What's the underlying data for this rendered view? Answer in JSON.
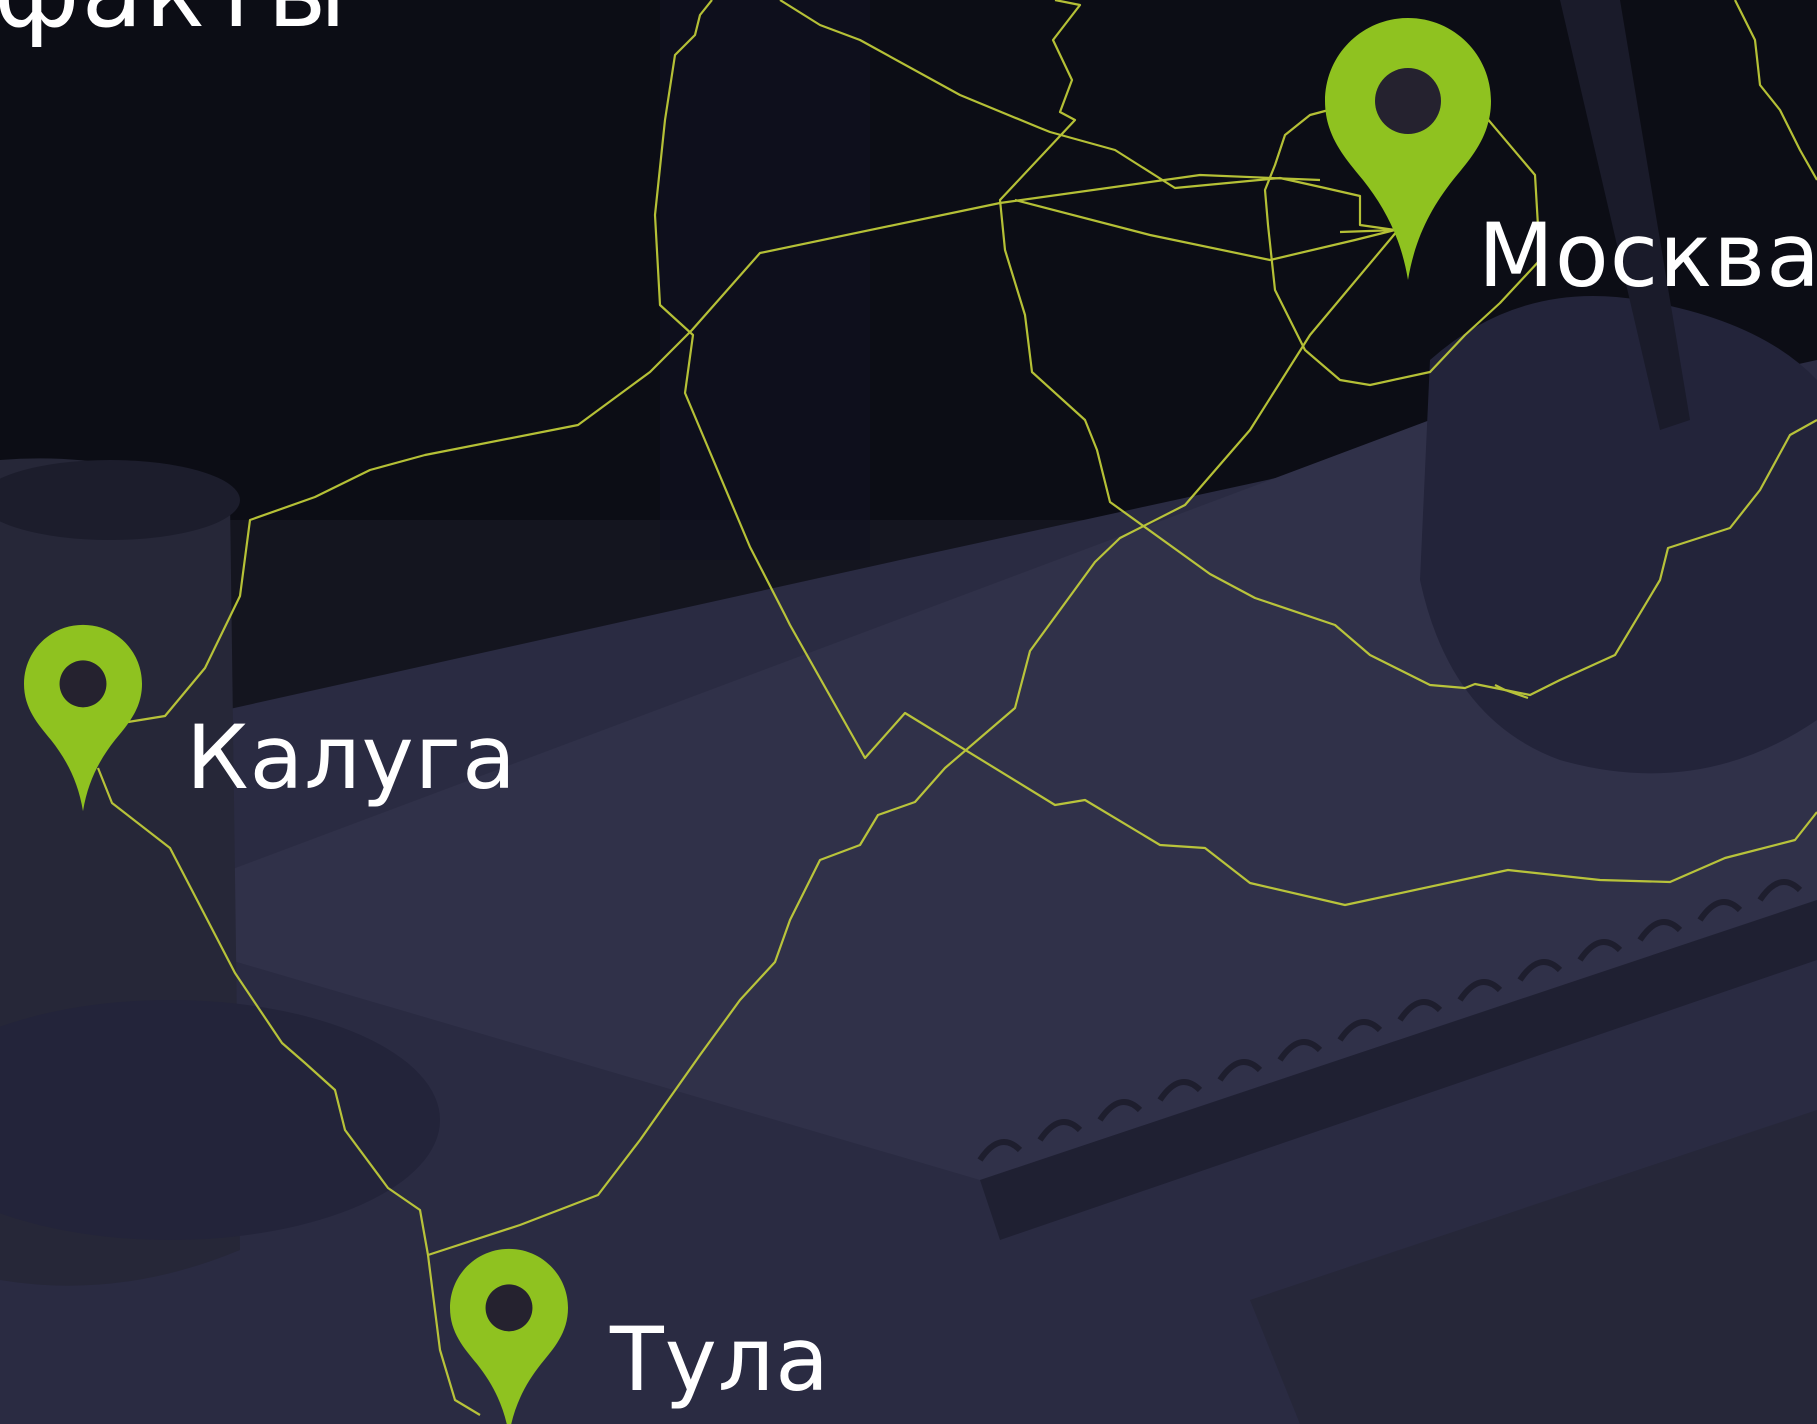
{
  "page": {
    "heading": "факты"
  },
  "map": {
    "pin_color": "#8fc220",
    "pin_dot_color": "#25222f",
    "route_color": "#c8d43a",
    "cities": [
      {
        "name": "Москва"
      },
      {
        "name": "Калуга"
      },
      {
        "name": "Тула"
      }
    ]
  }
}
